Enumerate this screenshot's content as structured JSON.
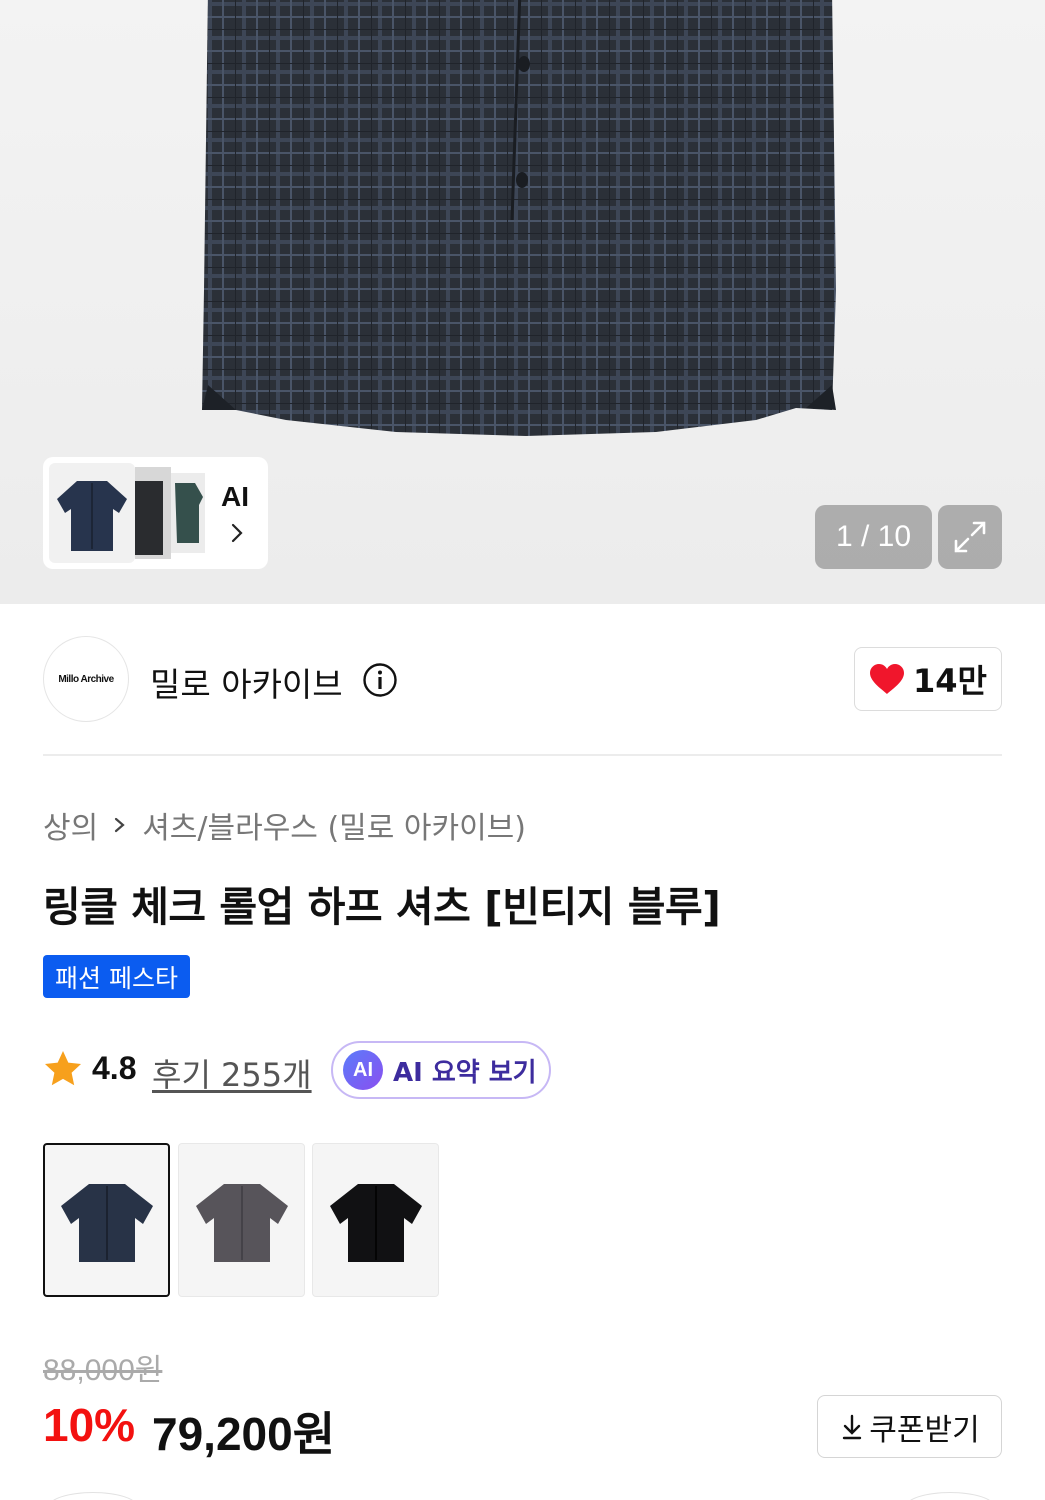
{
  "gallery": {
    "ai_label": "AI",
    "counter": "1 / 10",
    "icons": {
      "ai_chevron": "chevron-right-icon",
      "expand": "expand-icon"
    }
  },
  "brand": {
    "logo_text": "Millo Archive",
    "name": "밀로 아카이브",
    "like_count": "14만",
    "icons": {
      "info": "info-icon",
      "heart": "heart-icon"
    },
    "heart_color": "#f0162c"
  },
  "breadcrumb": {
    "category": "상의",
    "subcategory": "셔츠/블라우스 (밀로 아카이브)"
  },
  "product": {
    "title": "링클 체크 롤업 하프 셔츠 [빈티지 블루]",
    "badge": "패션 페스타",
    "badge_color": "#0b5cf0",
    "rating": "4.8",
    "reviews": "후기 255개",
    "ai_summary_icon": "AI",
    "ai_summary_label": "AI 요약 보기"
  },
  "colors": [
    {
      "name": "navy-check",
      "selected": true
    },
    {
      "name": "charcoal",
      "selected": false
    },
    {
      "name": "black",
      "selected": false
    }
  ],
  "price": {
    "original": "88,000원",
    "discount": "10%",
    "sale": "79,200원",
    "coupon_label": "쿠폰받기",
    "discount_color": "#f31110"
  }
}
